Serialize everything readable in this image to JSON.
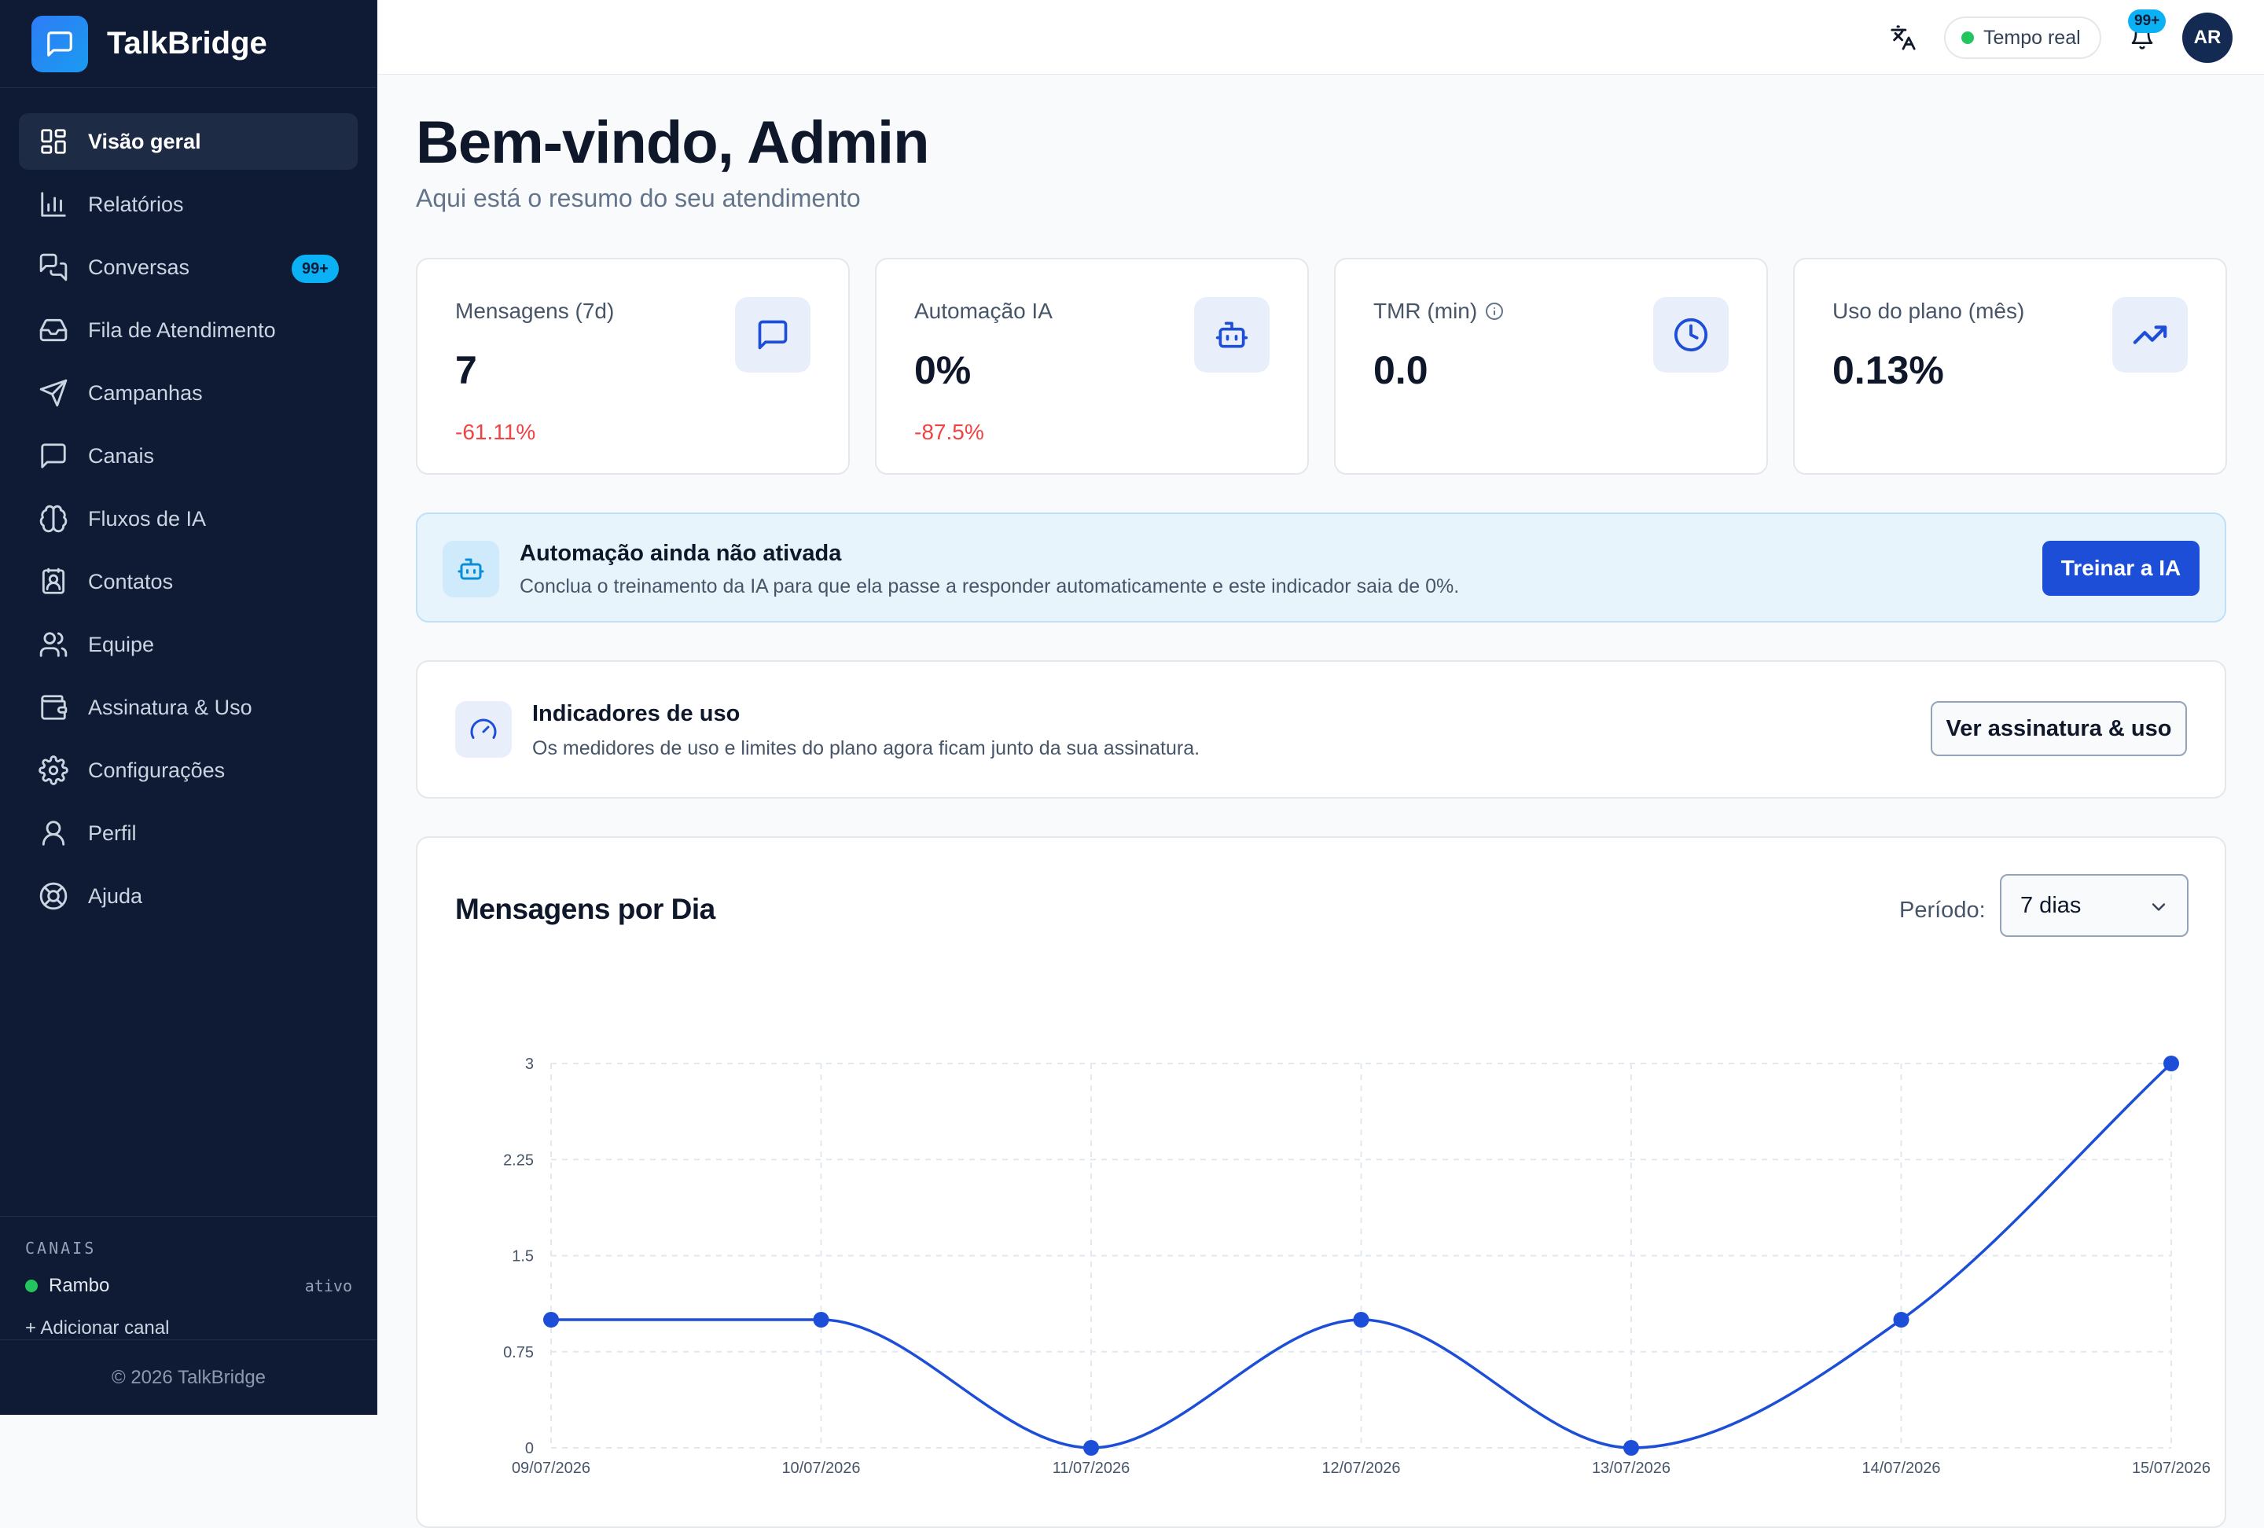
{
  "app": {
    "name": "TalkBridge"
  },
  "sidebar": {
    "items": [
      {
        "label": "Visão geral",
        "icon": "dashboard-icon",
        "active": true
      },
      {
        "label": "Relatórios",
        "icon": "bar-chart-icon"
      },
      {
        "label": "Conversas",
        "icon": "chat-icon",
        "badge": "99+"
      },
      {
        "label": "Fila de Atendimento",
        "icon": "inbox-icon"
      },
      {
        "label": "Campanhas",
        "icon": "send-icon"
      },
      {
        "label": "Canais",
        "icon": "message-square-icon"
      },
      {
        "label": "Fluxos de IA",
        "icon": "brain-icon"
      },
      {
        "label": "Contatos",
        "icon": "contact-book-icon"
      },
      {
        "label": "Equipe",
        "icon": "users-icon"
      },
      {
        "label": "Assinatura & Uso",
        "icon": "wallet-icon"
      },
      {
        "label": "Configurações",
        "icon": "gear-icon"
      },
      {
        "label": "Perfil",
        "icon": "user-icon"
      },
      {
        "label": "Ajuda",
        "icon": "lifebuoy-icon"
      }
    ],
    "channels_caption": "CANAIS",
    "channels": [
      {
        "name": "Rambo",
        "status": "ativo"
      }
    ],
    "add_channel": "+ Adicionar canal",
    "footer": "© 2026 TalkBridge"
  },
  "topbar": {
    "realtime_label": "Tempo real",
    "notifications_badge": "99+",
    "avatar_initials": "AR"
  },
  "header": {
    "title": "Bem-vindo, Admin",
    "subtitle": "Aqui está o resumo do seu atendimento"
  },
  "kpis": [
    {
      "label": "Mensagens (7d)",
      "value": "7",
      "delta": "-61.11%",
      "icon": "chat-icon"
    },
    {
      "label": "Automação IA",
      "value": "0%",
      "delta": "-87.5%",
      "icon": "robot-icon"
    },
    {
      "label": "TMR (min)",
      "value": "0.0",
      "delta": "",
      "icon": "clock-icon",
      "info": true
    },
    {
      "label": "Uso do plano (mês)",
      "value": "0.13%",
      "delta": "",
      "icon": "trending-up-icon"
    }
  ],
  "automation_banner": {
    "title": "Automação ainda não ativada",
    "description": "Conclua o treinamento da IA para que ela passe a responder automaticamente e este indicador saia de 0%.",
    "button": "Treinar a IA"
  },
  "usage_card": {
    "title": "Indicadores de uso",
    "description": "Os medidores de uso e limites do plano agora ficam junto da sua assinatura.",
    "button": "Ver assinatura & uso"
  },
  "chart_section": {
    "title": "Mensagens por Dia",
    "period_label": "Período:",
    "period_value": "7 dias"
  },
  "colors": {
    "accent": "#1d4ed8",
    "sidebar_bg": "#0f1b34",
    "badge": "#0ab2f5",
    "negative": "#ef4444",
    "online": "#22c55e"
  },
  "chart_data": {
    "type": "line",
    "categories": [
      "09/07/2026",
      "10/07/2026",
      "11/07/2026",
      "12/07/2026",
      "13/07/2026",
      "14/07/2026",
      "15/07/2026"
    ],
    "values": [
      1,
      1,
      0,
      1,
      0,
      1,
      3
    ],
    "yticks": [
      "0",
      "0.75",
      "1.5",
      "2.25",
      "3"
    ],
    "ylim": [
      0,
      3
    ],
    "grid": true,
    "title": "Mensagens por Dia",
    "xlabel": "",
    "ylabel": ""
  }
}
